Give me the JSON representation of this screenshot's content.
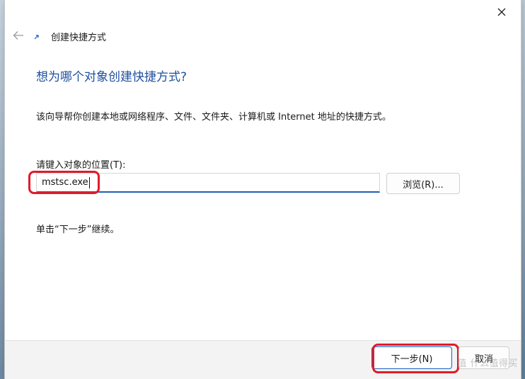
{
  "window": {
    "title": "创建快捷方式",
    "close_icon": "close-icon",
    "back_icon": "back-arrow-icon",
    "wizard_icon": "shortcut-wizard-icon"
  },
  "wizard": {
    "heading": "想为哪个对象创建快捷方式?",
    "description": "该向导帮你创建本地或网络程序、文件、文件夹、计算机或 Internet 地址的快捷方式。",
    "location_label": "请键入对象的位置(T):",
    "location_value": "mstsc.exe",
    "browse_label": "浏览(R)...",
    "continue_hint": "单击“下一步”继续。"
  },
  "footer": {
    "next_label": "下一步(N)",
    "cancel_label": "取消"
  },
  "watermark": {
    "text": "值 什么值得买"
  },
  "colors": {
    "heading": "#1d4e9e",
    "input_focus": "#1f5fb4",
    "annotation": "#e21b2a",
    "footer_bg": "#f3f3f3"
  }
}
